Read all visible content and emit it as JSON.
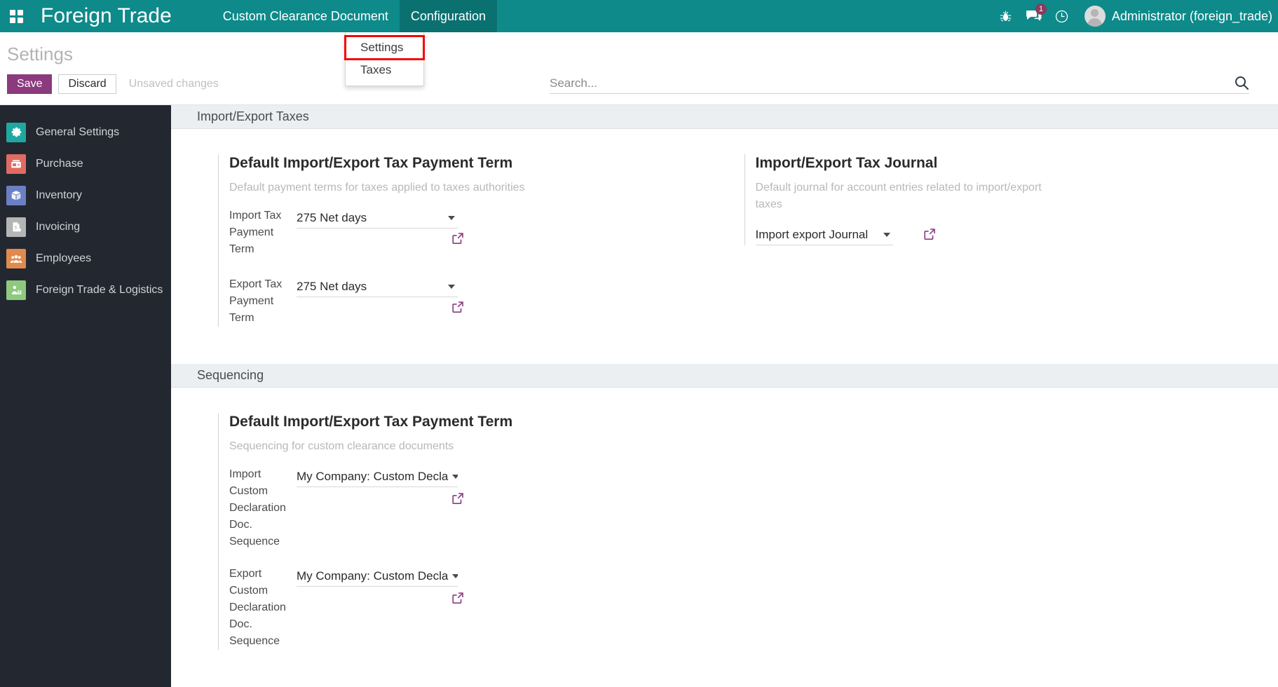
{
  "topbar": {
    "apps_icon": "apps-grid-icon",
    "brand": "Foreign Trade",
    "menus": [
      {
        "label": "Custom Clearance Document",
        "open": false
      },
      {
        "label": "Configuration",
        "open": true
      }
    ],
    "debug_icon": "bug-icon",
    "messages_icon": "messages-icon",
    "messages_count": "1",
    "activity_icon": "clock-icon",
    "avatar_icon": "avatar",
    "user_name": "Administrator (foreign_trade)"
  },
  "dropdown": {
    "items": [
      {
        "label": "Settings",
        "highlighted": true
      },
      {
        "label": "Taxes",
        "highlighted": false
      }
    ]
  },
  "control_panel": {
    "title": "Settings",
    "save_label": "Save",
    "discard_label": "Discard",
    "status_text": "Unsaved changes",
    "search_placeholder": "Search...",
    "search_value": "",
    "search_icon": "search-icon"
  },
  "sidebar": {
    "items": [
      {
        "label": "General Settings",
        "icon": "gear-icon",
        "color": "#1fa8a0"
      },
      {
        "label": "Purchase",
        "icon": "purchase-card-icon",
        "color": "#e06b62"
      },
      {
        "label": "Inventory",
        "icon": "box-icon",
        "color": "#6b7fc4"
      },
      {
        "label": "Invoicing",
        "icon": "invoice-dollar-icon",
        "color": "#b5b5b5"
      },
      {
        "label": "Employees",
        "icon": "people-icon",
        "color": "#e08a4e"
      },
      {
        "label": "Foreign Trade & Logistics",
        "icon": "trade-worker-icon",
        "color": "#8ec97f"
      }
    ]
  },
  "main": {
    "sections": [
      {
        "heading": "Import/Export Taxes",
        "blocks": [
          {
            "title": "Default Import/Export Tax Payment Term",
            "description": "Default payment terms for taxes applied to taxes authorities",
            "fields": [
              {
                "label": "Import Tax Payment Term",
                "value": "275 Net days",
                "link_icon": "external-link-icon"
              },
              {
                "label": "Export Tax Payment Term",
                "value": "275 Net days",
                "link_icon": "external-link-icon"
              }
            ]
          },
          {
            "title": "Import/Export Tax Journal",
            "description": "Default journal for account entries related to import/export taxes",
            "fields": [
              {
                "label": "",
                "value": "Import export Journal",
                "link_icon": "external-link-icon"
              }
            ]
          }
        ]
      },
      {
        "heading": "Sequencing",
        "blocks": [
          {
            "title": "Default Import/Export Tax Payment Term",
            "description": "Sequencing for custom clearance documents",
            "fields": [
              {
                "label": "Import Custom Declaration Doc. Sequence",
                "value": "My Company: Custom Decla",
                "link_icon": "external-link-icon"
              },
              {
                "label": "Export Custom Declaration Doc. Sequence",
                "value": "My Company: Custom Decla",
                "link_icon": "external-link-icon"
              }
            ]
          }
        ]
      }
    ]
  },
  "colors": {
    "brand_teal": "#0e8a8a",
    "accent_purple": "#8b3a7e",
    "sidebar_dark": "#232830",
    "highlight_red": "#f30707"
  }
}
